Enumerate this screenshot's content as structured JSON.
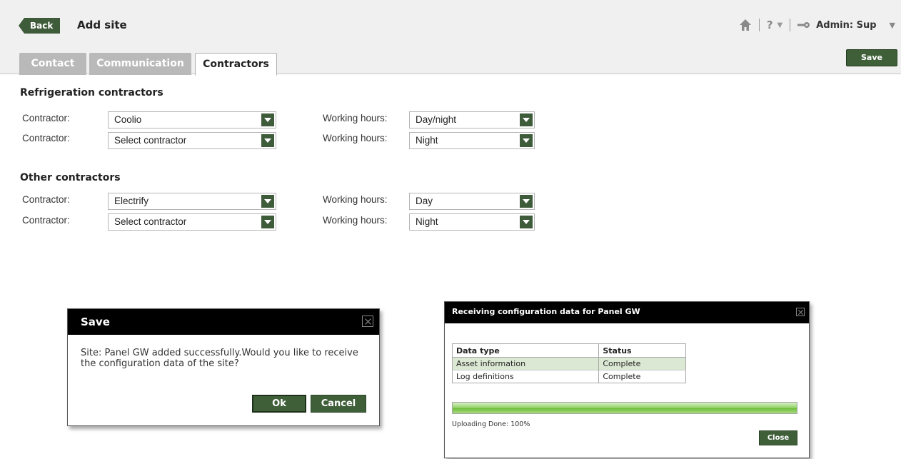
{
  "header": {
    "back_label": "Back",
    "title": "Add site",
    "help_symbol": "?",
    "user_label": "Admin: Sup",
    "save_label": "Save"
  },
  "tabs": [
    {
      "label": "Contact",
      "active": false
    },
    {
      "label": "Communication",
      "active": false
    },
    {
      "label": "Contractors",
      "active": true
    }
  ],
  "refrigeration": {
    "title": "Refrigeration contractors",
    "rows": [
      {
        "contractor_label": "Contractor:",
        "contractor": "Coolio",
        "hours_label": "Working hours:",
        "hours": "Day/night"
      },
      {
        "contractor_label": "Contractor:",
        "contractor": "Select contractor",
        "hours_label": "Working hours:",
        "hours": "Night"
      }
    ]
  },
  "other": {
    "title": "Other contractors",
    "rows": [
      {
        "contractor_label": "Contractor:",
        "contractor": "Electrify",
        "hours_label": "Working hours:",
        "hours": "Day"
      },
      {
        "contractor_label": "Contractor:",
        "contractor": "Select contractor",
        "hours_label": "Working hours:",
        "hours": "Night"
      }
    ]
  },
  "save_dialog": {
    "title": "Save",
    "message": "Site: Panel GW added successfully.Would you like to receive the configuration data of the site?",
    "ok_label": "Ok",
    "cancel_label": "Cancel"
  },
  "receive_dialog": {
    "title": "Receiving configuration data for Panel GW",
    "columns": [
      "Data type",
      "Status"
    ],
    "rows": [
      [
        "Asset information",
        "Complete"
      ],
      [
        "Log definitions",
        "Complete"
      ]
    ],
    "progress_percent": 100,
    "status_text": "Uploading Done: 100%",
    "close_label": "Close"
  },
  "colors": {
    "accent": "#3e5b3a",
    "selected_row": "#dbe8d4",
    "progress": "#6fbe3e"
  }
}
